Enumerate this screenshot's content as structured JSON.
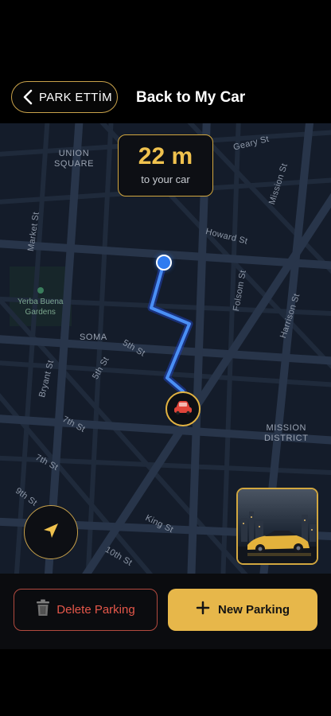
{
  "header": {
    "back_label": "PARK ETTİM",
    "title": "Back to My Car"
  },
  "distance": {
    "value": "22 m",
    "caption": "to your car"
  },
  "map": {
    "streets": [
      "Geary St",
      "Mission St",
      "Howard St",
      "Market St",
      "Folsom St",
      "Harrison St",
      "5th St",
      "5th St",
      "Bryant St",
      "7th St",
      "7th St",
      "9th St",
      "King St",
      "10th St"
    ],
    "districts": [
      "UNION\nSQUARE",
      "SOMA",
      "MISSION\nDISTRICT"
    ],
    "park": "Yerba Buena\nGardens"
  },
  "actions": {
    "delete_label": "Delete Parking",
    "new_label": "New Parking"
  },
  "colors": {
    "accent": "#e7b74a",
    "danger": "#e5574a",
    "route": "#3b82f6"
  },
  "icons": [
    "chevron-left-icon",
    "location-arrow-icon",
    "car-icon",
    "trash-icon",
    "plus-icon"
  ]
}
